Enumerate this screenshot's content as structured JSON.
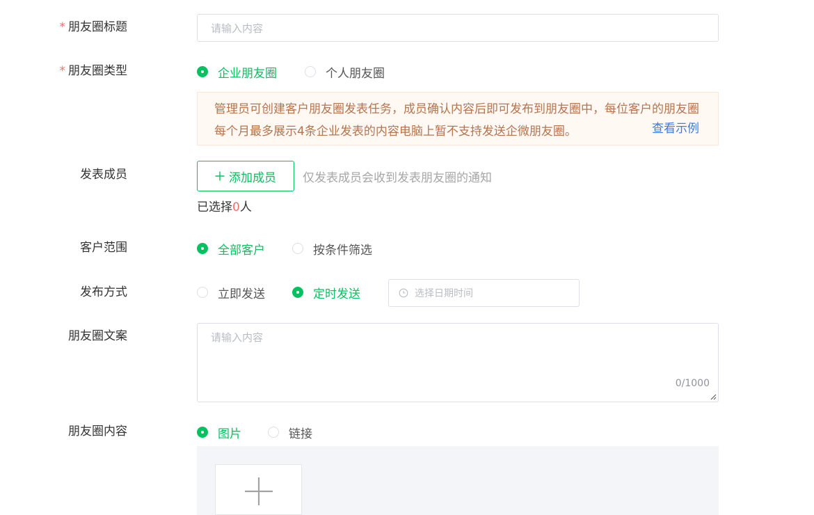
{
  "form": {
    "title": {
      "label": "朋友圈标题",
      "required_mark": "*",
      "placeholder": "请输入内容"
    },
    "type": {
      "label": "朋友圈类型",
      "required_mark": "*",
      "options": [
        {
          "label": "企业朋友圈",
          "selected": true
        },
        {
          "label": "个人朋友圈",
          "selected": false
        }
      ],
      "notice": "管理员可创建客户朋友圈发表任务，成员确认内容后即可发布到朋友圈中，每位客户的朋友圈每个月最多展示4条企业发表的内容电脑上暂不支持发送企微朋友圈。",
      "notice_link": "查看示例"
    },
    "members": {
      "label": "发表成员",
      "add_button": "添加成员",
      "hint": "仅发表成员会收到发表朋友圈的通知",
      "selected_prefix": "已选择",
      "selected_count": "0",
      "selected_suffix": "人"
    },
    "scope": {
      "label": "客户范围",
      "options": [
        {
          "label": "全部客户",
          "selected": true
        },
        {
          "label": "按条件筛选",
          "selected": false
        }
      ]
    },
    "publish": {
      "label": "发布方式",
      "options": [
        {
          "label": "立即发送",
          "selected": false
        },
        {
          "label": "定时发送",
          "selected": true
        }
      ],
      "datetime_placeholder": "选择日期时间"
    },
    "copy": {
      "label": "朋友圈文案",
      "placeholder": "请输入内容",
      "counter": "0/1000"
    },
    "content": {
      "label": "朋友圈内容",
      "options": [
        {
          "label": "图片",
          "selected": true
        },
        {
          "label": "链接",
          "selected": false
        }
      ]
    }
  },
  "colors": {
    "accent": "#07c160",
    "required": "#f56c6c",
    "link": "#3a7de0",
    "notice_text": "#b5744e",
    "notice_bg": "#fff8f3"
  },
  "icons": {
    "add": "plus-icon",
    "clock": "clock-icon",
    "upload": "plus-icon",
    "resize": "resize-handle-icon"
  }
}
